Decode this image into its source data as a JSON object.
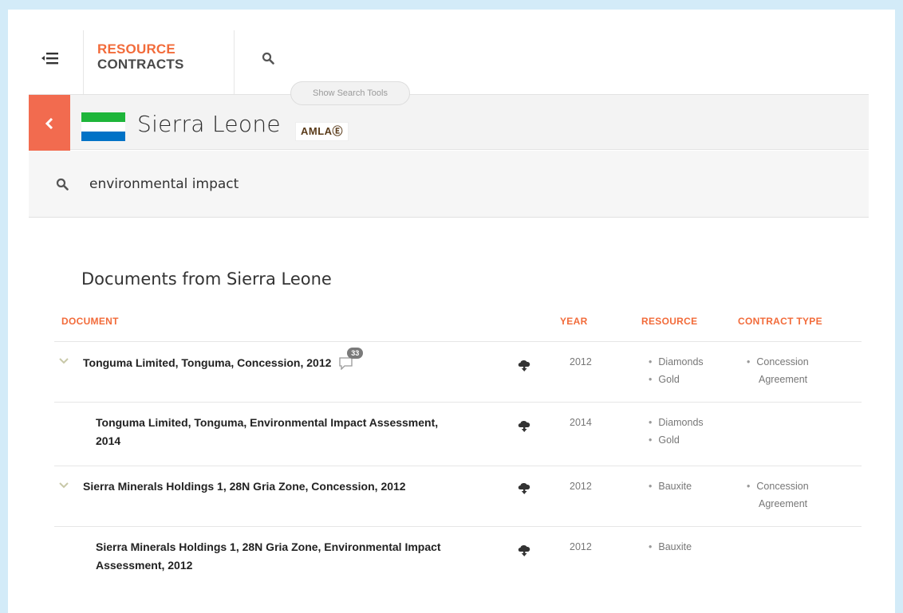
{
  "brand": {
    "line1": "RESOURCE",
    "line2": "CONTRACTS"
  },
  "search_tools_label": "Show Search Tools",
  "country": {
    "name": "Sierra Leone",
    "badge": "AMLAⒺ",
    "flag_colors": [
      "#1eb53a",
      "#ffffff",
      "#0072c6"
    ]
  },
  "search": {
    "query": "environmental impact"
  },
  "section_title": "Documents from Sierra Leone",
  "columns": {
    "document": "DOCUMENT",
    "year": "YEAR",
    "resource": "RESOURCE",
    "contract_type": "CONTRACT TYPE"
  },
  "rows": [
    {
      "title": "Tonguma Limited, Tonguma, Concession, 2012",
      "comments": "33",
      "year": "2012",
      "resources": [
        "Diamonds",
        "Gold"
      ],
      "contract_type_line1": "Concession",
      "contract_type_line2": "Agreement"
    },
    {
      "title_line1": "Tonguma Limited, Tonguma, Environmental Impact Assessment,",
      "title_line2": "2014",
      "year": "2014",
      "resources": [
        "Diamonds",
        "Gold"
      ]
    },
    {
      "title": "Sierra Minerals Holdings 1, 28N Gria Zone, Concession, 2012",
      "year": "2012",
      "resources": [
        "Bauxite"
      ],
      "contract_type_line1": "Concession",
      "contract_type_line2": "Agreement"
    },
    {
      "title_line1": "Sierra Minerals Holdings 1, 28N Gria Zone, Environmental Impact",
      "title_line2": "Assessment, 2012",
      "year": "2012",
      "resources": [
        "Bauxite"
      ]
    }
  ],
  "colors": {
    "accent": "#f26b3a",
    "back_button": "#f26b4f",
    "background": "#d3ebf8"
  }
}
